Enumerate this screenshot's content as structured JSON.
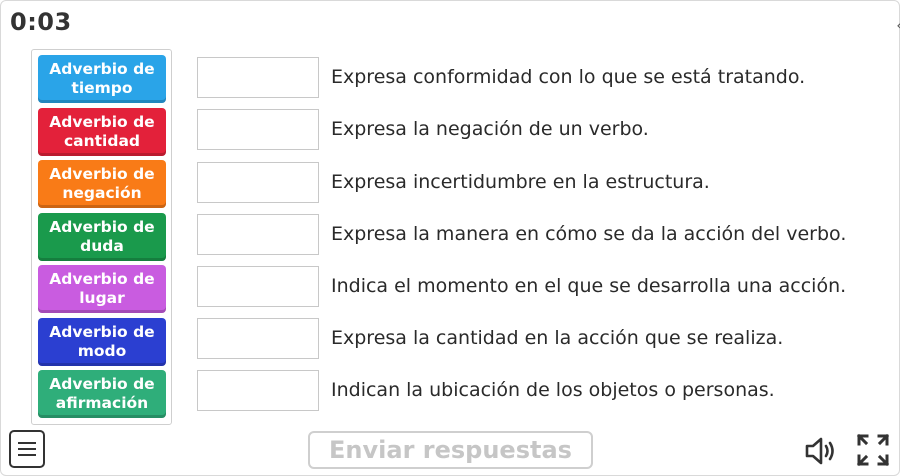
{
  "timer": "0:03",
  "tiles": [
    {
      "label": "Adverbio de tiempo",
      "color": "#2aa4e8"
    },
    {
      "label": "Adverbio de cantidad",
      "color": "#e3213a"
    },
    {
      "label": "Adverbio de negación",
      "color": "#f97b17"
    },
    {
      "label": "Adverbio de duda",
      "color": "#1a9a4c"
    },
    {
      "label": "Adverbio de lugar",
      "color": "#c95ce0"
    },
    {
      "label": "Adverbio de modo",
      "color": "#2b3fd1"
    },
    {
      "label": "Adverbio de afirmación",
      "color": "#2fae7a"
    }
  ],
  "rows": [
    {
      "text": "Expresa conformidad con lo que se está tratando."
    },
    {
      "text": "Expresa la negación de un verbo."
    },
    {
      "text": "Expresa incertidumbre en la estructura."
    },
    {
      "text": "Expresa la manera en cómo se da la acción del verbo."
    },
    {
      "text": "Indica el momento en el que se desarrolla una acción."
    },
    {
      "text": "Expresa la cantidad en la acción que se realiza."
    },
    {
      "text": "Indican la ubicación de los objetos o personas."
    }
  ],
  "submit_label": "Enviar respuestas",
  "icons": {
    "menu": "menu-icon",
    "sound": "speaker-icon",
    "fullscreen": "fullscreen-icon"
  }
}
